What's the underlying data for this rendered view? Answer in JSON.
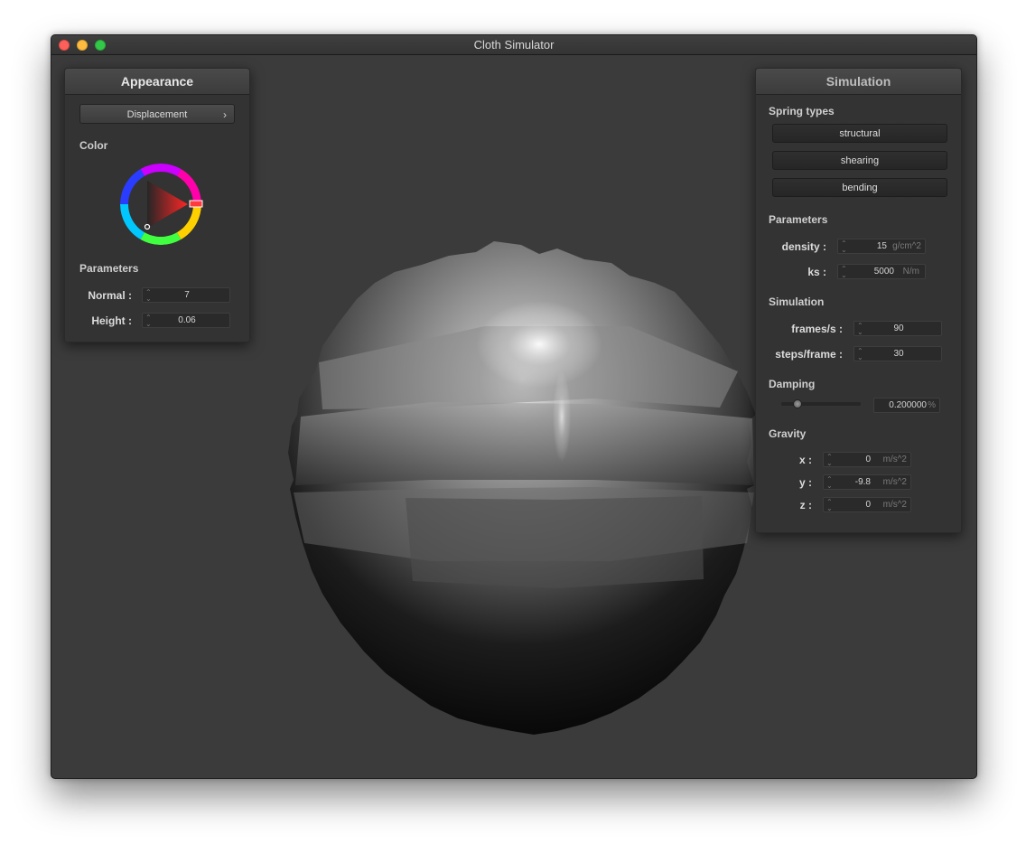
{
  "window": {
    "title": "Cloth Simulator"
  },
  "appearance": {
    "title": "Appearance",
    "shader_dropdown": "Displacement",
    "color_label": "Color",
    "params_label": "Parameters",
    "normal_label": "Normal :",
    "normal_value": "7",
    "height_label": "Height :",
    "height_value": "0.06",
    "wheel_color": "#ff0000"
  },
  "simulation": {
    "title": "Simulation",
    "spring_types_label": "Spring types",
    "spring_buttons": [
      "structural",
      "shearing",
      "bending"
    ],
    "params_label": "Parameters",
    "density_label": "density :",
    "density_value": "15",
    "density_unit": "g/cm^2",
    "ks_label": "ks :",
    "ks_value": "5000",
    "ks_unit": "N/m",
    "sim_label": "Simulation",
    "fps_label": "frames/s :",
    "fps_value": "90",
    "steps_label": "steps/frame :",
    "steps_value": "30",
    "damping_label": "Damping",
    "damping_value": "0.200000",
    "damping_unit": "%",
    "damping_level": 0.2,
    "gravity_label": "Gravity",
    "gx_label": "x :",
    "gx_value": "0",
    "gy_label": "y :",
    "gy_value": "-9.8",
    "gz_label": "z :",
    "gz_value": "0",
    "gravity_unit": "m/s^2"
  }
}
